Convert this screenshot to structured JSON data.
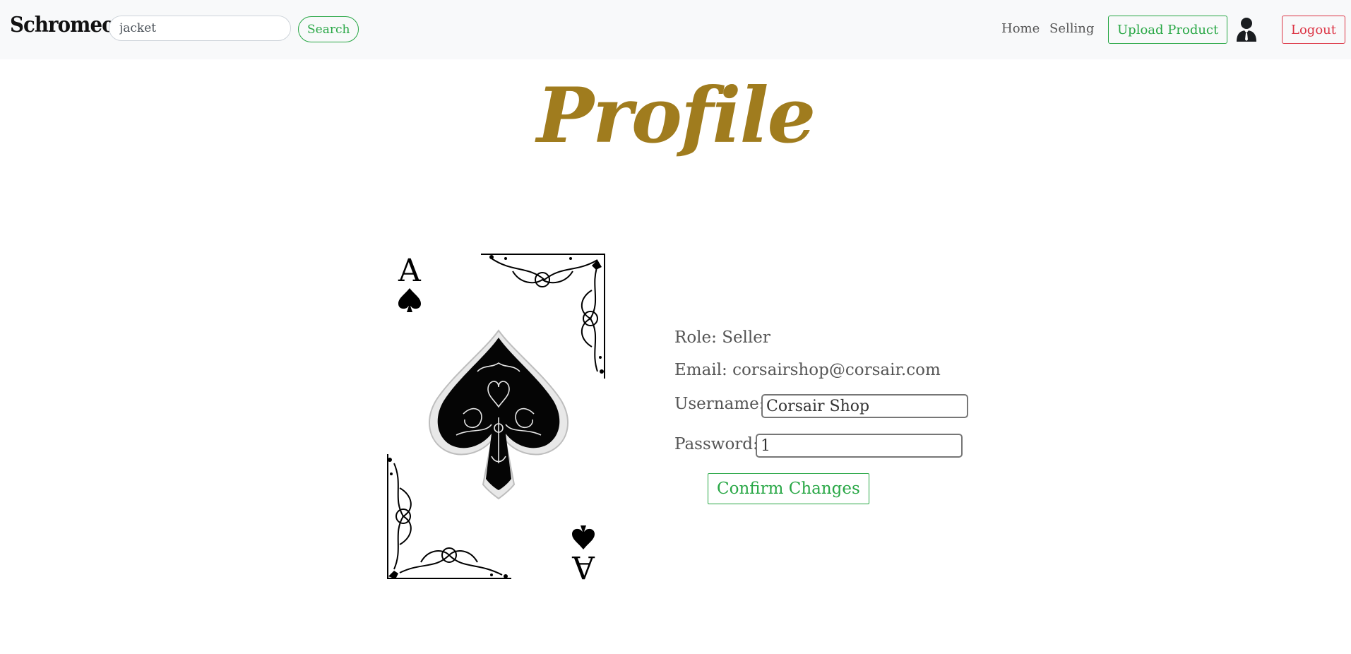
{
  "navbar": {
    "brand": "Schromeo",
    "search": {
      "value": "jacket",
      "placeholder": "Search"
    },
    "search_button": "Search",
    "links": [
      "Home",
      "Selling"
    ],
    "upload_button": "Upload Product",
    "user_icon": "user-icon",
    "logout_button": "Logout"
  },
  "page": {
    "title": "Profile"
  },
  "profile": {
    "card_image": "ace-of-spades-card",
    "role_line": "Role: Seller",
    "email_line": "Email: corsairshop@corsair.com",
    "username_label": "Username:",
    "username_value": "Corsair Shop",
    "password_label": "Password:",
    "password_value": "1",
    "confirm_button": "Confirm Changes"
  },
  "colors": {
    "navbar_bg": "#f8f9fa",
    "title": "#a07c1e",
    "success": "#28a745",
    "danger": "#dc3545",
    "text": "#555555"
  }
}
